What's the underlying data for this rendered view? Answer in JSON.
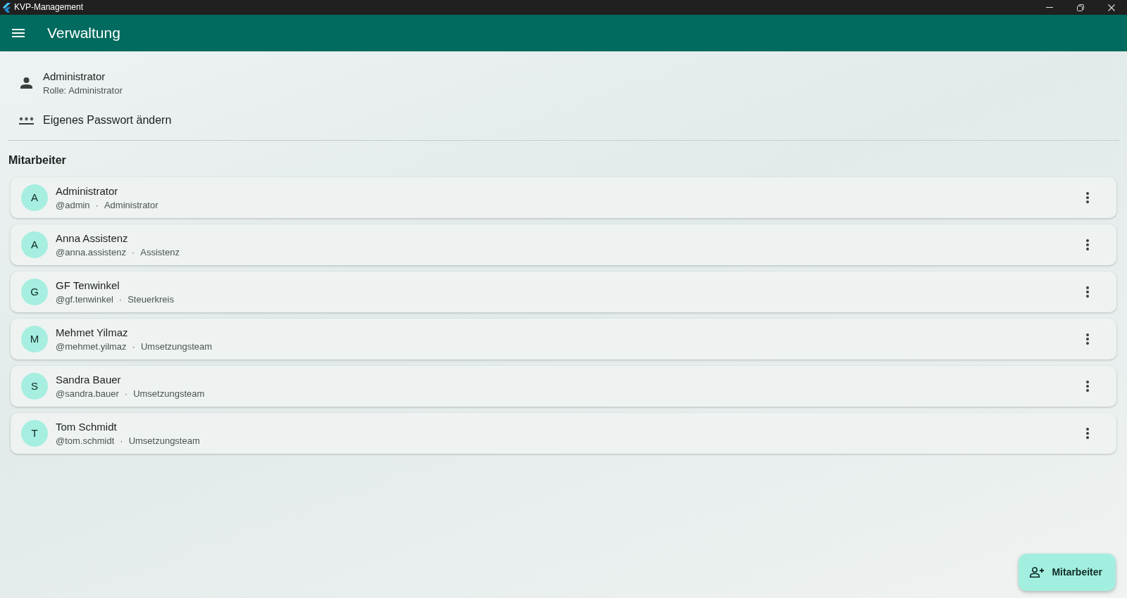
{
  "window": {
    "title": "KVP-Management"
  },
  "app_bar": {
    "title": "Verwaltung"
  },
  "profile": {
    "name": "Administrator",
    "role_line": "Rolle: Administrator"
  },
  "actions": [
    {
      "label": "Eigenes Passwort ändern"
    }
  ],
  "section": {
    "title": "Mitarbeiter"
  },
  "employees": [
    {
      "initial": "A",
      "name": "Administrator",
      "username": "@admin",
      "separator": "·",
      "role": "Administrator"
    },
    {
      "initial": "A",
      "name": "Anna Assistenz",
      "username": "@anna.assistenz",
      "separator": "·",
      "role": "Assistenz"
    },
    {
      "initial": "G",
      "name": "GF Tenwinkel",
      "username": "@gf.tenwinkel",
      "separator": "·",
      "role": "Steuerkreis"
    },
    {
      "initial": "M",
      "name": "Mehmet Yilmaz",
      "username": "@mehmet.yilmaz",
      "separator": "·",
      "role": "Umsetzungsteam"
    },
    {
      "initial": "S",
      "name": "Sandra Bauer",
      "username": "@sandra.bauer",
      "separator": "·",
      "role": "Umsetzungsteam"
    },
    {
      "initial": "T",
      "name": "Tom Schmidt",
      "username": "@tom.schmidt",
      "separator": "·",
      "role": "Umsetzungsteam"
    }
  ],
  "fab": {
    "label": "Mitarbeiter"
  }
}
